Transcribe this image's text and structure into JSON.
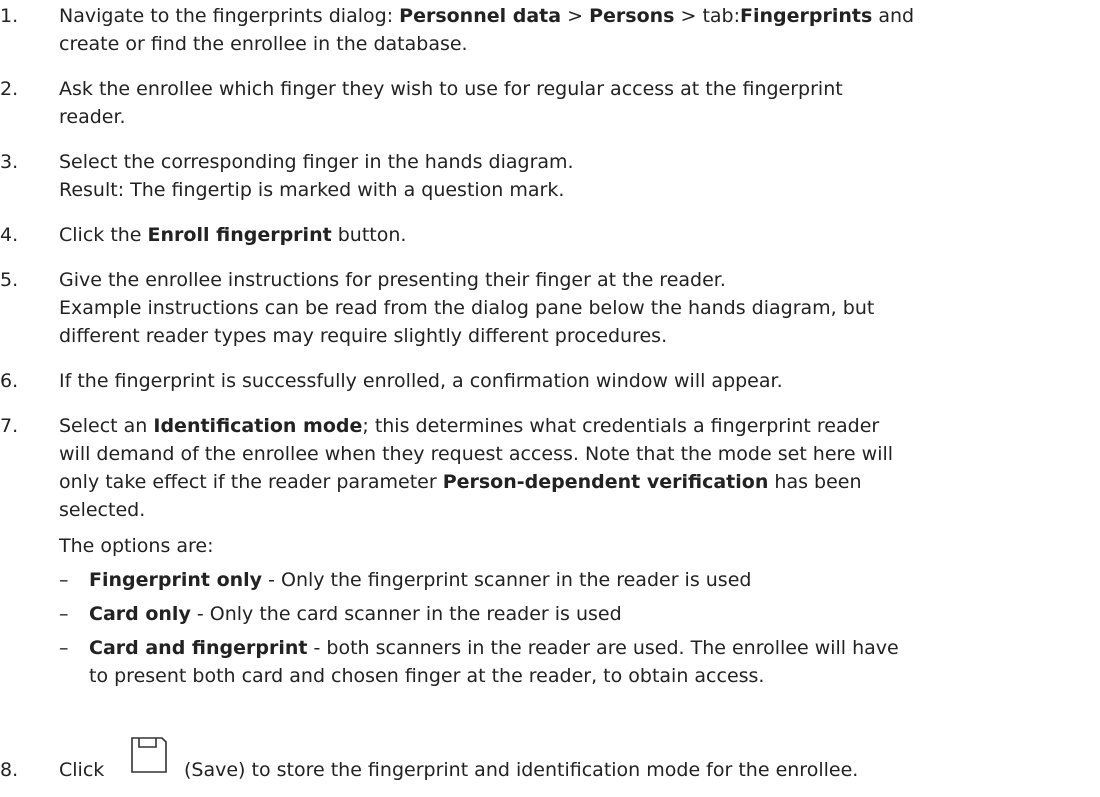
{
  "steps": [
    {
      "num": "1.",
      "l1": [
        "Navigate to the fingerprints dialog: ",
        "Personnel data",
        " > ",
        "Persons",
        " > tab:",
        "Fingerprints",
        " and"
      ],
      "l2": "create or find the enrollee in the database."
    },
    {
      "num": "2.",
      "l1": "Ask the enrollee which finger they wish to use for regular access at the fingerprint",
      "l2": "reader."
    },
    {
      "num": "3.",
      "l1": "Select the corresponding finger in the hands diagram.",
      "l2": "Result: The fingertip is marked with a question mark."
    },
    {
      "num": "4.",
      "l1": [
        "Click the ",
        "Enroll fingerprint",
        " button."
      ]
    },
    {
      "num": "5.",
      "l1": "Give the enrollee instructions for presenting their finger at the reader.",
      "l2": "Example instructions can be read from the dialog pane below the hands diagram, but",
      "l3": "different reader types may require slightly different procedures."
    },
    {
      "num": "6.",
      "l1": "If the fingerprint is successfully enrolled, a confirmation window will appear."
    },
    {
      "num": "7.",
      "l1": [
        "Select an ",
        "Identification mode",
        "; this determines what credentials a fingerprint reader"
      ],
      "l2": "will demand of the enrollee when they request access. Note that the mode set here will",
      "l3": [
        "only take effect if the reader parameter ",
        "Person-dependent verification",
        " has been"
      ],
      "l4": "selected.",
      "l5": "The options are:",
      "options": [
        {
          "dash": "–",
          "name": "Fingerprint only",
          "desc": " - Only the fingerprint scanner in the reader is used"
        },
        {
          "dash": "–",
          "name": "Card only",
          "desc": " - Only the card scanner in the reader is used"
        },
        {
          "dash": "–",
          "name": "Card and fingerprint",
          "desc": " - both scanners in the reader are used. The enrollee will have",
          "desc2": "to present both card and chosen finger at the reader, to obtain access."
        }
      ]
    },
    {
      "num": "8.",
      "pre": "Click",
      "icon": "save-icon",
      "post": "(Save) to store the fingerprint and identification mode for the enrollee."
    }
  ]
}
